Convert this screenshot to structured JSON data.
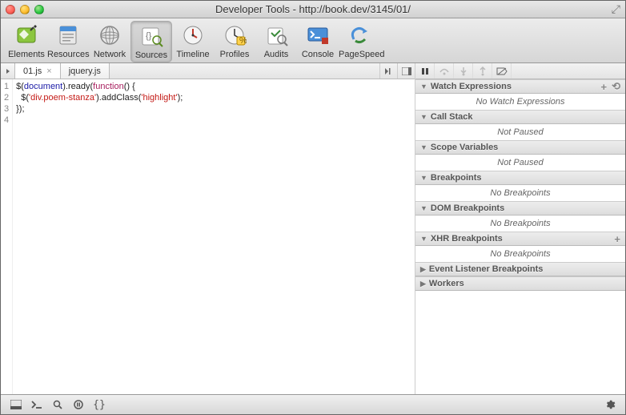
{
  "window": {
    "title": "Developer Tools - http://book.dev/3145/01/"
  },
  "toolbar": {
    "items": [
      {
        "label": "Elements"
      },
      {
        "label": "Resources"
      },
      {
        "label": "Network"
      },
      {
        "label": "Sources"
      },
      {
        "label": "Timeline"
      },
      {
        "label": "Profiles"
      },
      {
        "label": "Audits"
      },
      {
        "label": "Console"
      },
      {
        "label": "PageSpeed"
      }
    ],
    "active_index": 3
  },
  "tabs": {
    "items": [
      {
        "label": "01.js",
        "closable": true
      },
      {
        "label": "jquery.js",
        "closable": false
      }
    ],
    "active_index": 0
  },
  "source": {
    "filename": "01.js",
    "lines": [
      {
        "n": 1,
        "tokens": [
          {
            "t": "$",
            "c": "pun"
          },
          {
            "t": "(",
            "c": "pun"
          },
          {
            "t": "document",
            "c": "doc"
          },
          {
            "t": ")",
            "c": "pun"
          },
          {
            "t": ".",
            "c": "pun"
          },
          {
            "t": "ready",
            "c": "fn"
          },
          {
            "t": "(",
            "c": "pun"
          },
          {
            "t": "function",
            "c": "kw"
          },
          {
            "t": "() {",
            "c": "pun"
          }
        ]
      },
      {
        "n": 2,
        "tokens": [
          {
            "t": "  $",
            "c": "pun"
          },
          {
            "t": "(",
            "c": "pun"
          },
          {
            "t": "'div.poem-stanza'",
            "c": "str"
          },
          {
            "t": ")",
            "c": "pun"
          },
          {
            "t": ".",
            "c": "pun"
          },
          {
            "t": "addClass",
            "c": "fn"
          },
          {
            "t": "(",
            "c": "pun"
          },
          {
            "t": "'highlight'",
            "c": "str"
          },
          {
            "t": ");",
            "c": "pun"
          }
        ]
      },
      {
        "n": 3,
        "tokens": [
          {
            "t": "});",
            "c": "pun"
          }
        ]
      },
      {
        "n": 4,
        "tokens": []
      }
    ]
  },
  "debug_panels": {
    "watch": {
      "title": "Watch Expressions",
      "body": "No Watch Expressions",
      "expanded": true,
      "actions": [
        "add",
        "refresh"
      ]
    },
    "callstack": {
      "title": "Call Stack",
      "body": "Not Paused",
      "expanded": true
    },
    "scope": {
      "title": "Scope Variables",
      "body": "Not Paused",
      "expanded": true
    },
    "breakpoints": {
      "title": "Breakpoints",
      "body": "No Breakpoints",
      "expanded": true
    },
    "dom": {
      "title": "DOM Breakpoints",
      "body": "No Breakpoints",
      "expanded": true
    },
    "xhr": {
      "title": "XHR Breakpoints",
      "body": "No Breakpoints",
      "expanded": true,
      "actions": [
        "add"
      ]
    },
    "event": {
      "title": "Event Listener Breakpoints",
      "expanded": false
    },
    "workers": {
      "title": "Workers",
      "expanded": false
    }
  },
  "debug_controls": {
    "buttons": [
      "pause",
      "step-over",
      "step-into",
      "step-out",
      "deactivate-breakpoints"
    ]
  }
}
